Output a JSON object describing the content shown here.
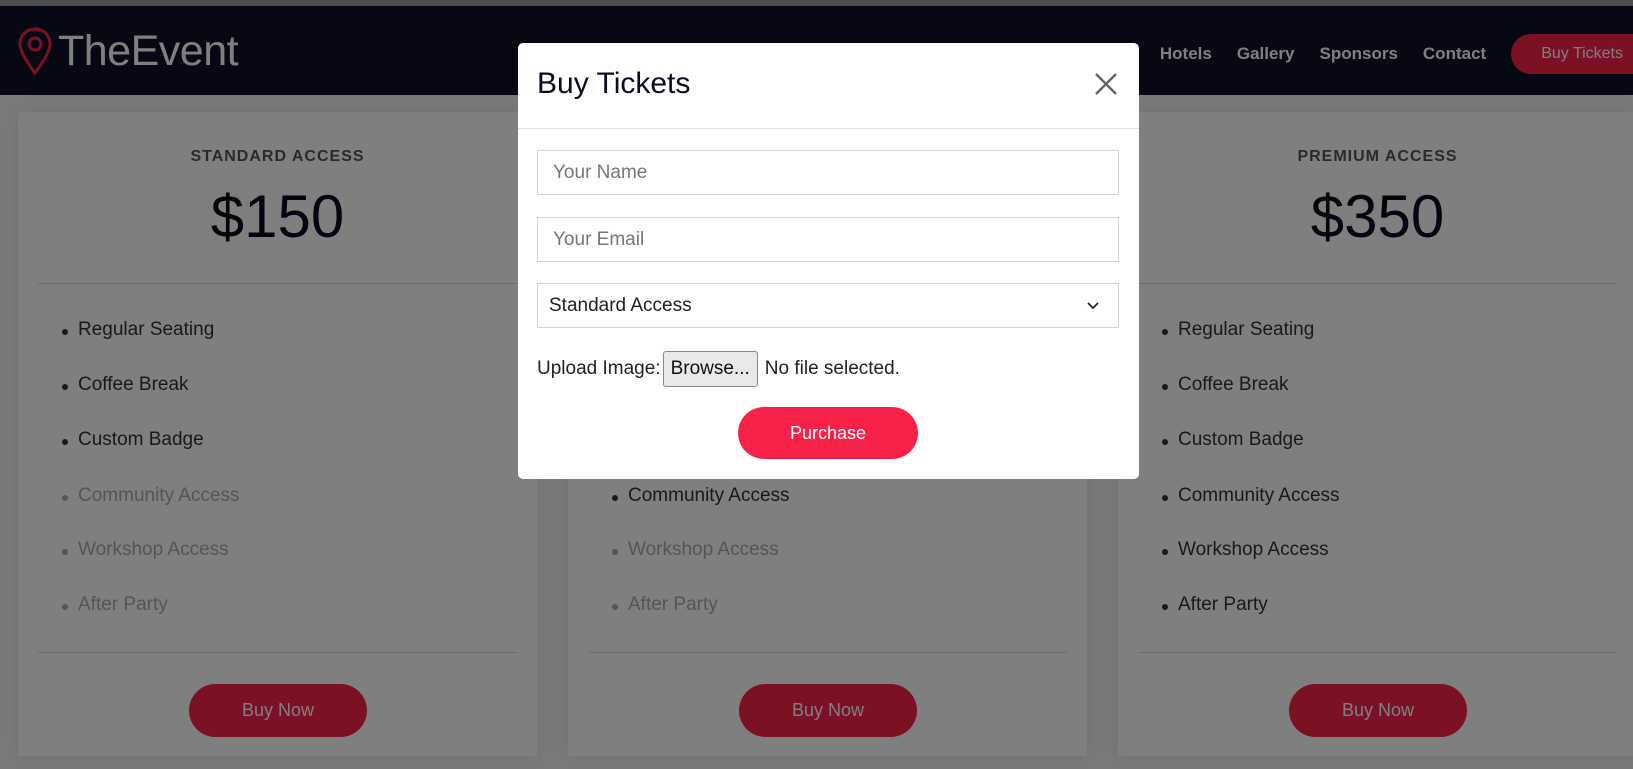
{
  "navbar": {
    "logo": "TheEvent",
    "links": [
      "Hotels",
      "Gallery",
      "Sponsors",
      "Contact"
    ],
    "cta": "Buy Tickets"
  },
  "cards": [
    {
      "title": "STANDARD ACCESS",
      "price": "$150",
      "items": [
        {
          "label": "Regular Seating",
          "included": true
        },
        {
          "label": "Coffee Break",
          "included": true
        },
        {
          "label": "Custom Badge",
          "included": true
        },
        {
          "label": "Community Access",
          "included": false
        },
        {
          "label": "Workshop Access",
          "included": false
        },
        {
          "label": "After Party",
          "included": false
        }
      ],
      "button": "Buy Now"
    },
    {
      "items": [
        {
          "label": "Community Access",
          "included": true
        },
        {
          "label": "Workshop Access",
          "included": false
        },
        {
          "label": "After Party",
          "included": false
        }
      ],
      "button": "Buy Now"
    },
    {
      "title": "PREMIUM ACCESS",
      "price": "$350",
      "items": [
        {
          "label": "Regular Seating",
          "included": true
        },
        {
          "label": "Coffee Break",
          "included": true
        },
        {
          "label": "Custom Badge",
          "included": true
        },
        {
          "label": "Community Access",
          "included": true
        },
        {
          "label": "Workshop Access",
          "included": true
        },
        {
          "label": "After Party",
          "included": true
        }
      ],
      "button": "Buy Now"
    }
  ],
  "modal": {
    "title": "Buy Tickets",
    "name_placeholder": "Your Name",
    "email_placeholder": "Your Email",
    "ticket_type": "Standard Access",
    "upload_label": "Upload Image:",
    "browse": "Browse...",
    "file_status": "No file selected.",
    "submit": "Purchase"
  },
  "colors": {
    "accent": "#f82249",
    "navbar": "#0c1226",
    "title": "#060c22"
  }
}
